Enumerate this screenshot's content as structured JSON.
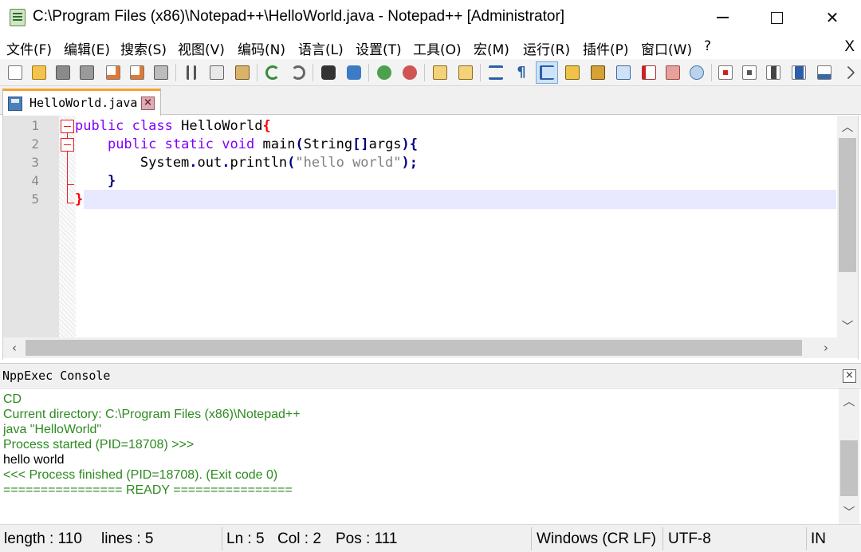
{
  "window": {
    "title": "C:\\Program Files (x86)\\Notepad++\\HelloWorld.java - Notepad++ [Administrator]"
  },
  "menu": {
    "items": [
      "文件(F)",
      "编辑(E)",
      "搜索(S)",
      "视图(V)",
      "编码(N)",
      "语言(L)",
      "设置(T)",
      "工具(O)",
      "宏(M)",
      "运行(R)",
      "插件(P)",
      "窗口(W)",
      "?"
    ],
    "close_label": "X"
  },
  "toolbar": {
    "icons": [
      "new-file-icon",
      "open-file-icon",
      "save-icon",
      "save-all-icon",
      "close-icon",
      "close-all-icon",
      "print-icon",
      "cut-icon",
      "copy-icon",
      "paste-icon",
      "undo-icon",
      "redo-icon",
      "find-icon",
      "replace-icon",
      "zoom-in-icon",
      "zoom-out-icon",
      "sync-vertical-icon",
      "sync-horizontal-icon",
      "word-wrap-icon",
      "show-all-chars-icon",
      "indent-guide-icon",
      "udl-icon",
      "doc-map-icon",
      "doc-list-icon",
      "function-list-icon",
      "folder-workspace-icon",
      "monitoring-icon",
      "record-macro-icon",
      "stop-macro-icon",
      "play-macro-icon",
      "run-macro-multiple-icon",
      "save-macro-icon"
    ],
    "active_icon": "indent-guide-icon"
  },
  "tab": {
    "label": "HelloWorld.java"
  },
  "editor": {
    "line_numbers": [
      "1",
      "2",
      "3",
      "4",
      "5"
    ],
    "lines": [
      [
        {
          "t": "public",
          "c": "kw"
        },
        {
          "t": " ",
          "c": "plain"
        },
        {
          "t": "class",
          "c": "kw"
        },
        {
          "t": " HelloWorld",
          "c": "plain"
        },
        {
          "t": "{",
          "c": "br"
        }
      ],
      [
        {
          "t": "    ",
          "c": "plain"
        },
        {
          "t": "public",
          "c": "kw"
        },
        {
          "t": " ",
          "c": "plain"
        },
        {
          "t": "static",
          "c": "kw"
        },
        {
          "t": " ",
          "c": "plain"
        },
        {
          "t": "void",
          "c": "kw"
        },
        {
          "t": " main",
          "c": "plain"
        },
        {
          "t": "(",
          "c": "op"
        },
        {
          "t": "String",
          "c": "plain"
        },
        {
          "t": "[]",
          "c": "op"
        },
        {
          "t": "args",
          "c": "plain"
        },
        {
          "t": "){",
          "c": "op"
        }
      ],
      [
        {
          "t": "        System",
          "c": "plain"
        },
        {
          "t": ".",
          "c": "op"
        },
        {
          "t": "out",
          "c": "plain"
        },
        {
          "t": ".",
          "c": "op"
        },
        {
          "t": "println",
          "c": "plain"
        },
        {
          "t": "(",
          "c": "op"
        },
        {
          "t": "\"hello world\"",
          "c": "str"
        },
        {
          "t": ");",
          "c": "op"
        }
      ],
      [
        {
          "t": "    ",
          "c": "plain"
        },
        {
          "t": "}",
          "c": "op"
        }
      ],
      [
        {
          "t": "}",
          "c": "br"
        }
      ]
    ],
    "current_line": 5
  },
  "console": {
    "title": "NppExec Console",
    "lines": [
      {
        "text": "CD",
        "style": "con-green"
      },
      {
        "text": "Current directory: C:\\Program Files (x86)\\Notepad++",
        "style": "con-green"
      },
      {
        "text": "java \"HelloWorld\"",
        "style": "con-green"
      },
      {
        "text": "Process started (PID=18708) >>>",
        "style": "con-green"
      },
      {
        "text": "hello world",
        "style": "con-black"
      },
      {
        "text": "<<< Process finished (PID=18708). (Exit code 0)",
        "style": "con-green"
      },
      {
        "text": "================ READY ================",
        "style": "con-green"
      }
    ]
  },
  "status": {
    "length": "length : 110",
    "lines": "lines : 5",
    "ln": "Ln : 5",
    "col": "Col : 2",
    "pos": "Pos : 111",
    "eol": "Windows (CR LF)",
    "encoding": "UTF-8",
    "mode": "IN"
  },
  "colors": {
    "keyword": "#8000ff",
    "operator": "#000080",
    "brace_match": "#ff0000",
    "string": "#808080",
    "console_text": "#2d8a20",
    "current_line_bg": "#e8e8ff",
    "tab_accent": "#f7a12c"
  }
}
